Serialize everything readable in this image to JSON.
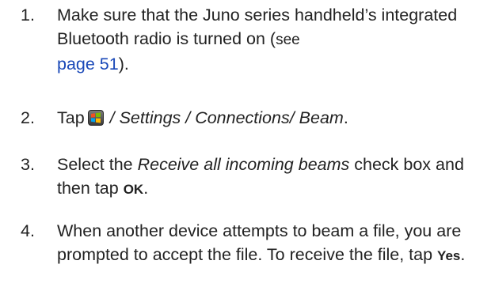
{
  "steps": [
    {
      "number": "1.",
      "text_a": "Make sure that the Juno series handheld’s integrated Bluetooth radio is turned on (",
      "text_see": "see",
      "link": "page 51",
      "text_b": ")."
    },
    {
      "number": "2.",
      "text_a": "Tap",
      "icon": "windows-start-icon",
      "path": " / Settings / Connections/ Beam",
      "text_b": "."
    },
    {
      "number": "3.",
      "text_a": "Select the ",
      "option": "Receive all incoming beams",
      "text_b": " check box and then tap ",
      "button": "OK",
      "text_c": "."
    },
    {
      "number": "4.",
      "text_a": "When another device attempts to beam a file, you are prompted to accept the file. To receive the file, tap ",
      "button": "Yes",
      "text_b": "."
    }
  ]
}
